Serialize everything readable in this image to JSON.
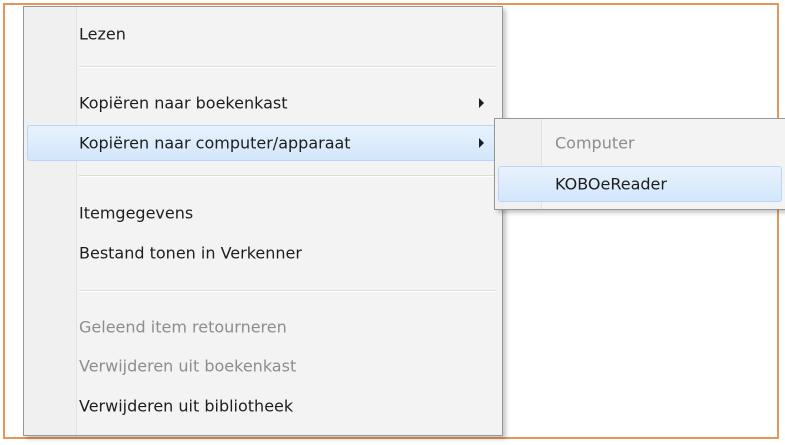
{
  "context_menu": {
    "items": [
      {
        "label": "Lezen"
      },
      {
        "label": "Kopiëren naar boekenkast"
      },
      {
        "label": "Kopiëren naar computer/apparaat"
      },
      {
        "label": "Itemgegevens"
      },
      {
        "label": "Bestand tonen in Verkenner"
      },
      {
        "label": "Geleend item retourneren"
      },
      {
        "label": "Verwijderen uit boekenkast"
      },
      {
        "label": "Verwijderen uit bibliotheek"
      }
    ]
  },
  "submenu": {
    "items": [
      {
        "label": "Computer"
      },
      {
        "label": "KOBOeReader"
      }
    ]
  },
  "colors": {
    "frame_border": "#e8955a",
    "highlight_border": "#b8d6fb",
    "disabled_text": "#8d8d8d"
  },
  "icons": [
    "submenu-arrow-icon"
  ]
}
